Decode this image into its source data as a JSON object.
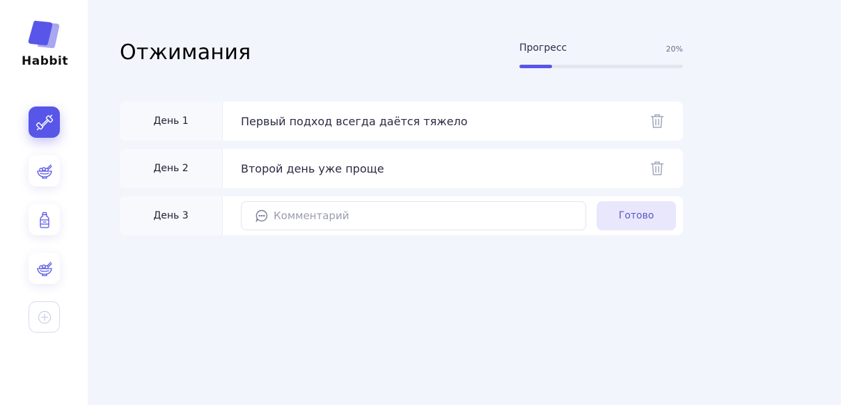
{
  "brand": {
    "name": "Habbit",
    "accent": "#5856e8"
  },
  "sidebar": {
    "items": [
      {
        "icon": "dumbbell-icon",
        "active": true
      },
      {
        "icon": "food-bowl-icon",
        "active": false
      },
      {
        "icon": "water-bottle-icon",
        "active": false
      },
      {
        "icon": "food-bowl-icon",
        "active": false
      },
      {
        "icon": "plus-circle-icon",
        "active": false
      }
    ]
  },
  "habit": {
    "title": "Отжимания",
    "progress_label": "Прогресс",
    "progress_value": "20%",
    "progress_fraction": 0.2
  },
  "days": [
    {
      "label": "День 1",
      "comment": "Первый подход всегда даётся тяжело"
    },
    {
      "label": "День 2",
      "comment": "Второй день уже проще"
    },
    {
      "label": "День 3",
      "placeholder": "Комментарий",
      "button": "Готово"
    }
  ]
}
